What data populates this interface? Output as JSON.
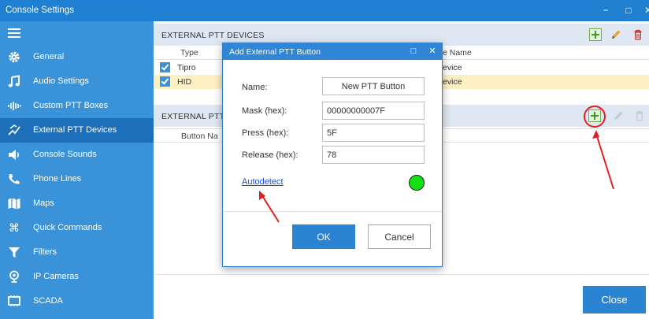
{
  "window": {
    "title": "Console Settings",
    "controls": {
      "minimize": "−",
      "maximize": "□",
      "close": "✕"
    }
  },
  "sidebar": {
    "items": [
      {
        "label": "General",
        "icon": "gear-icon"
      },
      {
        "label": "Audio Settings",
        "icon": "music-note-icon"
      },
      {
        "label": "Custom PTT Boxes",
        "icon": "audio-wave-icon"
      },
      {
        "label": "External PTT Devices",
        "icon": "device-hand-icon",
        "active": true
      },
      {
        "label": "Console Sounds",
        "icon": "speaker-icon"
      },
      {
        "label": "Phone Lines",
        "icon": "phone-icon"
      },
      {
        "label": "Maps",
        "icon": "map-icon"
      },
      {
        "label": "Quick Commands",
        "icon": "command-key-icon"
      },
      {
        "label": "Filters",
        "icon": "funnel-icon"
      },
      {
        "label": "IP Cameras",
        "icon": "camera-icon"
      },
      {
        "label": "SCADA",
        "icon": "monitor-icon"
      }
    ]
  },
  "devices_section": {
    "title": "EXTERNAL PTT DEVICES",
    "columns": {
      "type": "Type",
      "device_name": "e Name"
    },
    "rows": [
      {
        "checked": true,
        "type": "Tipro",
        "device": "evice"
      },
      {
        "checked": true,
        "type": "HID",
        "device": "evice"
      }
    ]
  },
  "buttons_section": {
    "title": "EXTERNAL PTT B",
    "columns": {
      "button_name": "Button Na"
    }
  },
  "dialog": {
    "title": "Add External PTT Button",
    "controls": {
      "maximize": "□",
      "close": "✕"
    },
    "fields": {
      "name": {
        "label": "Name:",
        "value": "New PTT Button"
      },
      "mask": {
        "label": "Mask (hex):",
        "value": "00000000007F"
      },
      "press": {
        "label": "Press (hex):",
        "value": "5F"
      },
      "release": {
        "label": "Release (hex):",
        "value": "78"
      }
    },
    "autodetect_label": "Autodetect",
    "status_color": "#12e012",
    "ok_label": "OK",
    "cancel_label": "Cancel"
  },
  "footer": {
    "close_label": "Close"
  },
  "colors": {
    "accent": "#2a84d2",
    "sidebar": "#3a92d8",
    "sidebar_active": "#1c6fb8",
    "selected_row": "#fdf1c4",
    "annotation": "#e02020"
  }
}
